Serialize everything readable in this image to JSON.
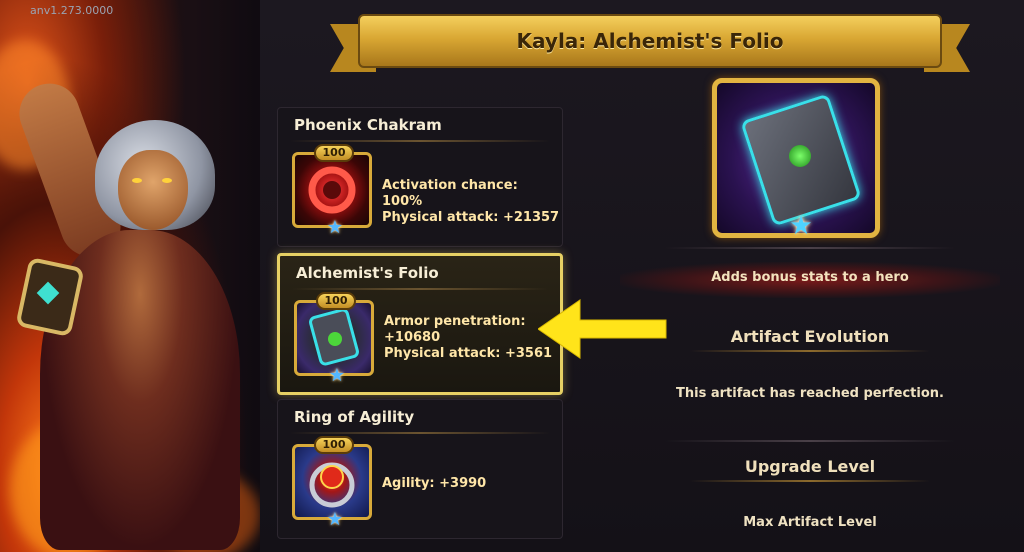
{
  "version": "anv1.273.0000",
  "title": "Kayla: Alchemist's Folio",
  "artifacts": [
    {
      "name": "Phoenix Chakram",
      "level": "100",
      "stat1": "Activation chance: 100%",
      "stat2": "Physical attack: +21357",
      "icon": "chakram-icon"
    },
    {
      "name": "Alchemist's Folio",
      "level": "100",
      "stat1": "Armor penetration:",
      "stat1b": "+10680",
      "stat2": "Physical attack: +3561",
      "icon": "folio-icon",
      "selected": true
    },
    {
      "name": "Ring of Agility",
      "level": "100",
      "stat1": "Agility: +3990",
      "icon": "ring-icon"
    }
  ],
  "detail": {
    "description": "Adds bonus stats to a hero",
    "evolution_title": "Artifact Evolution",
    "evolution_text": "This artifact has reached perfection.",
    "upgrade_title": "Upgrade Level",
    "upgrade_text": "Max Artifact Level"
  },
  "colors": {
    "gold": "#e2b441",
    "highlight": "#e6d064",
    "arrow": "#ffe41a"
  }
}
